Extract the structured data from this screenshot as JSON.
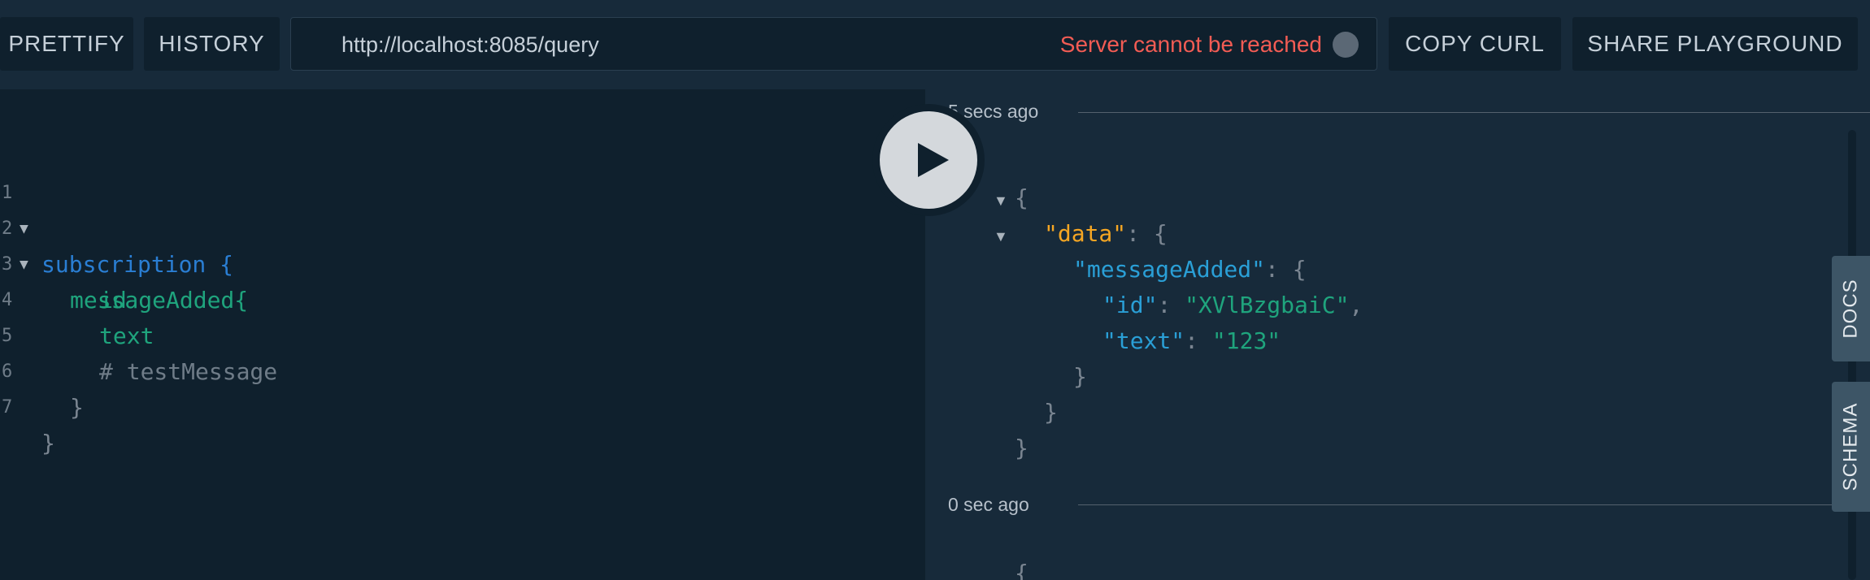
{
  "toolbar": {
    "prettify_label": "PRETTIFY",
    "history_label": "HISTORY",
    "endpoint_url": "http://localhost:8085/query",
    "server_status": "Server cannot be reached",
    "copy_curl_label": "COPY CURL",
    "share_label": "SHARE PLAYGROUND"
  },
  "editor": {
    "lines": [
      {
        "num": "1",
        "text": "subscription {"
      },
      {
        "num": "2",
        "text": "messageAdded{"
      },
      {
        "num": "3",
        "text": "id"
      },
      {
        "num": "4",
        "text": "text"
      },
      {
        "num": "5",
        "text": "# testMessage"
      },
      {
        "num": "6",
        "text": "}"
      },
      {
        "num": "7",
        "text": "}"
      }
    ]
  },
  "results": {
    "entries": [
      {
        "timestamp": "5 secs ago",
        "json": {
          "data_key": "\"data\"",
          "message_key": "\"messageAdded\"",
          "id_key": "\"id\"",
          "id_value": "\"XVlBzgbaiC\"",
          "text_key": "\"text\"",
          "text_value": "\"123\""
        }
      },
      {
        "timestamp": "0 sec ago"
      }
    ]
  },
  "side_tabs": {
    "docs_label": "DOCS",
    "schema_label": "SCHEMA"
  },
  "icons": {
    "play": "play-icon",
    "status": "status-dot-icon",
    "fold": "fold-arrow-icon"
  },
  "colors": {
    "keyword": "#2a7ed3",
    "field": "#1fa47d",
    "error": "#f25c54",
    "json_key_data": "#f5a623",
    "json_key": "#2a9fd6",
    "json_string": "#1fa47d"
  }
}
